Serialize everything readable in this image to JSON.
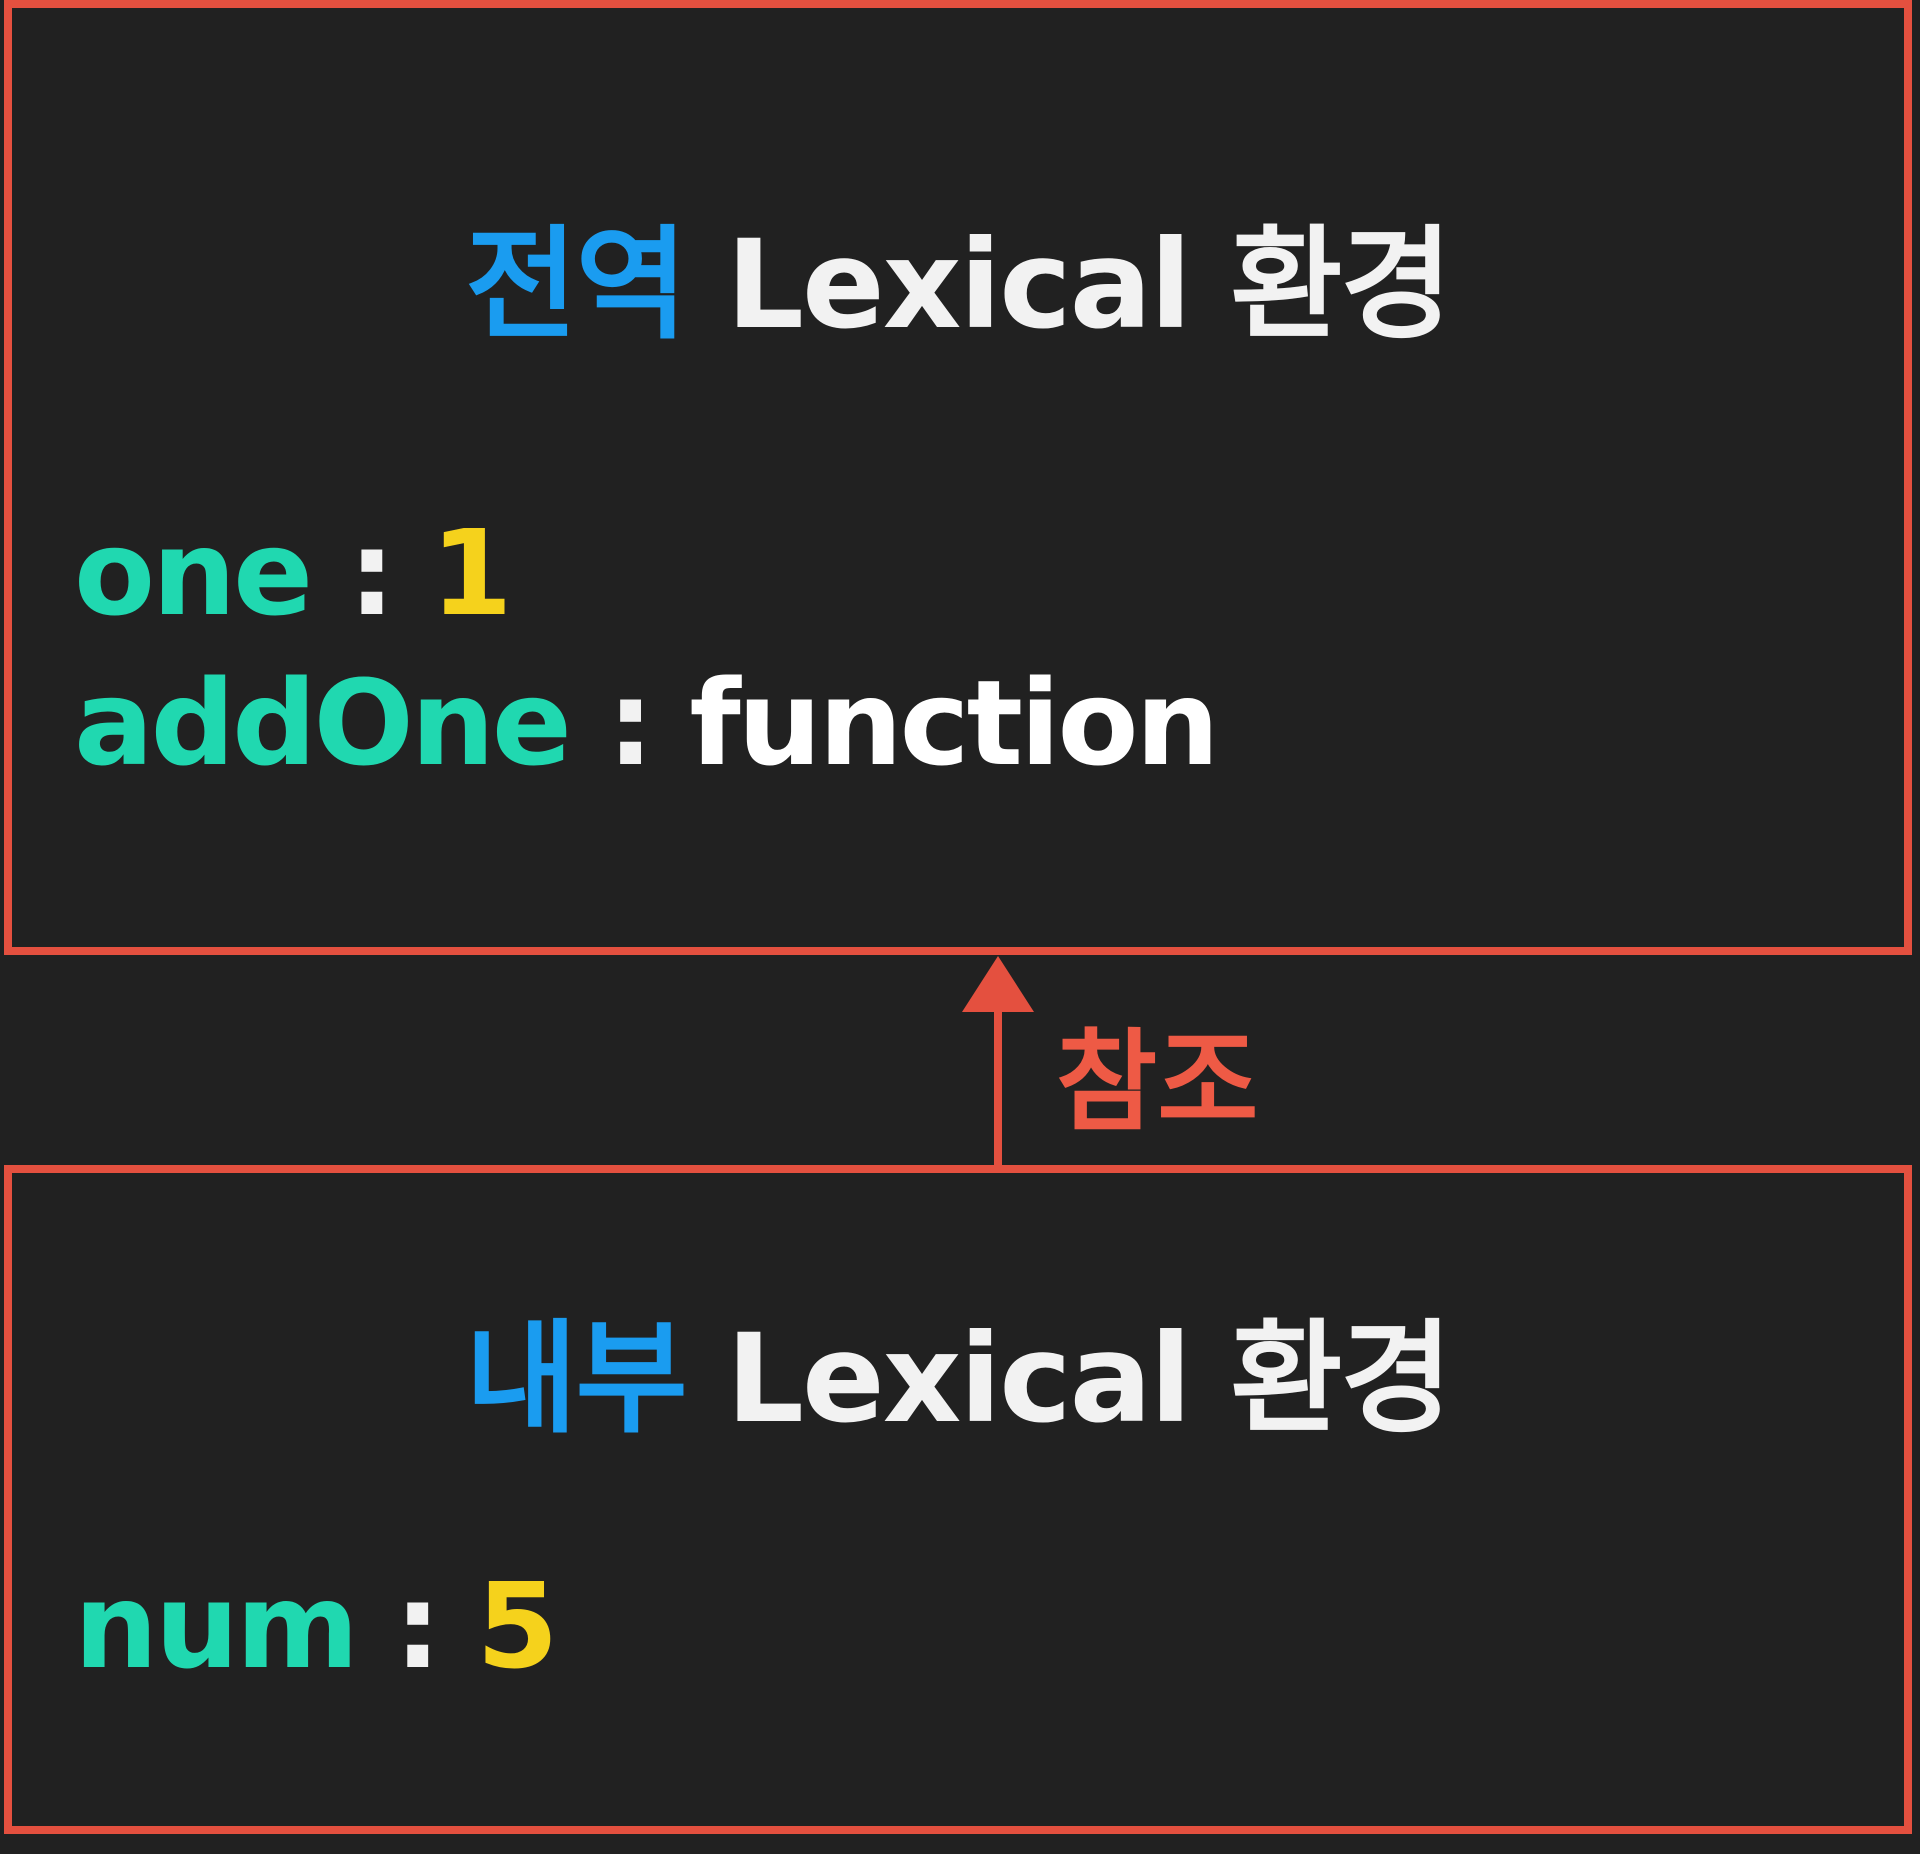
{
  "colors": {
    "border": "#e4503f",
    "background": "#212121",
    "title_accent": "#1a9cf0",
    "title_text": "#f2f2f2",
    "var_name": "#20d8b0",
    "var_number": "#f5d21c",
    "ref_label": "#ee5a45"
  },
  "global_env": {
    "title_accent": "전역",
    "title_rest": "Lexical 환경",
    "vars": [
      {
        "name": "one",
        "sep": ":",
        "value": "1"
      },
      {
        "name": "addOne",
        "sep": ":",
        "value": "function"
      }
    ]
  },
  "inner_env": {
    "title_accent": "내부",
    "title_rest": "Lexical 환경",
    "vars": [
      {
        "name": "num",
        "sep": ":",
        "value": "5"
      }
    ]
  },
  "reference": {
    "label": "참조"
  }
}
